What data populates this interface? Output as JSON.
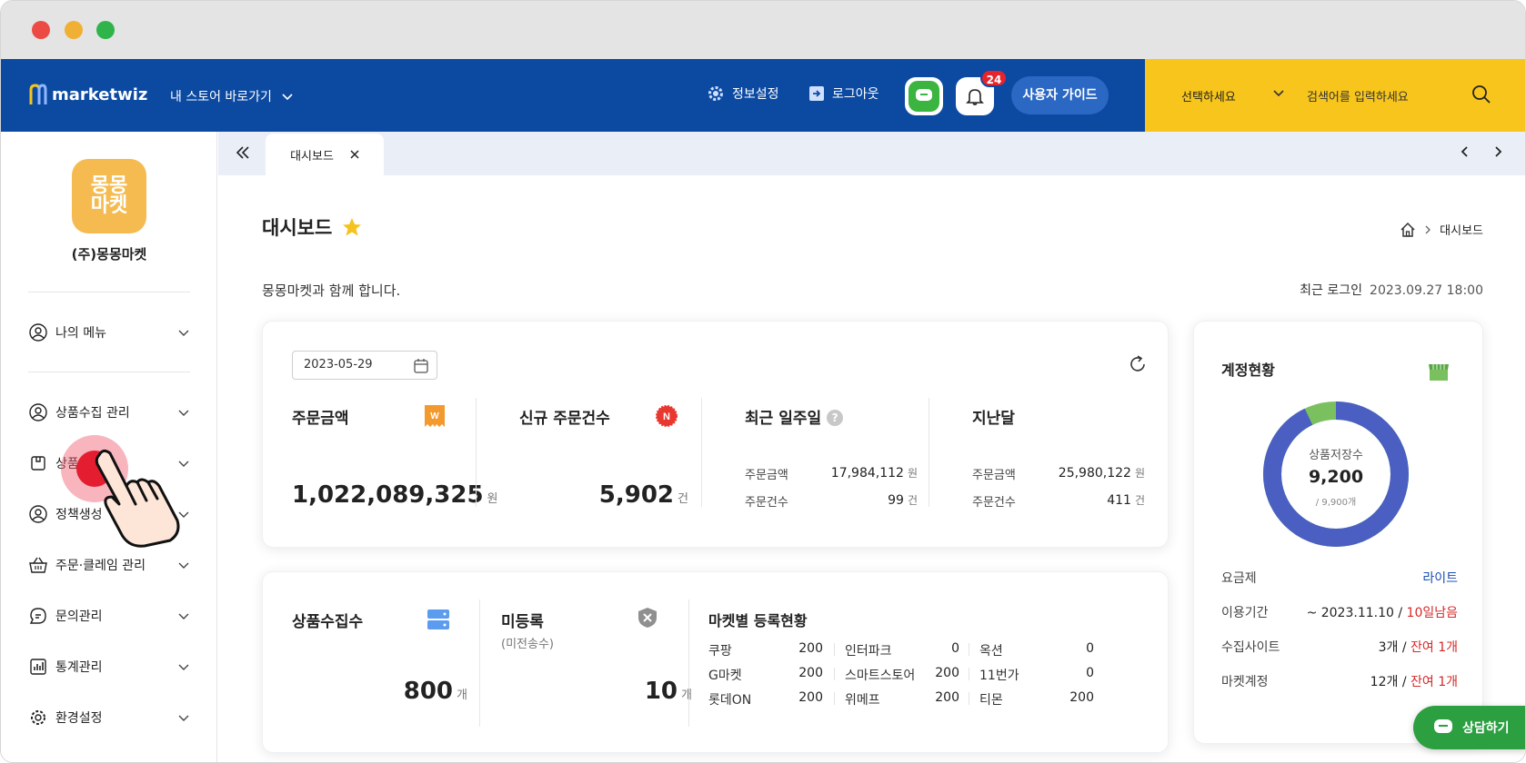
{
  "header": {
    "logo_text": "marketwiz",
    "store_link": "내 스토어 바로가기",
    "settings": "정보설정",
    "logout": "로그아웃",
    "notification_count": "24",
    "guide": "사용자 가이드",
    "select_label": "선택하세요",
    "search_placeholder": "검색어를 입력하세요"
  },
  "sidebar": {
    "shop_logo_text": "몽몽마켓",
    "shop_name": "(주)몽몽마켓",
    "items": [
      {
        "label": "나의 메뉴",
        "icon": "user-circle-icon"
      },
      {
        "label": "상품수집 관리",
        "icon": "user-circle-icon"
      },
      {
        "label": "상품",
        "icon": "box-icon"
      },
      {
        "label": "정책생성",
        "icon": "user-circle-icon"
      },
      {
        "label": "주문·클레임 관리",
        "icon": "basket-icon"
      },
      {
        "label": "문의관리",
        "icon": "chat-icon"
      },
      {
        "label": "통계관리",
        "icon": "bar-chart-icon"
      },
      {
        "label": "환경설정",
        "icon": "gear-icon"
      }
    ]
  },
  "tabs": {
    "active": "대시보드"
  },
  "page": {
    "title": "대시보드",
    "breadcrumb_current": "대시보드",
    "welcome": "몽몽마켓과 함께 합니다.",
    "last_login_label": "최근 로그인",
    "last_login_value": "2023.09.27 18:00"
  },
  "orders": {
    "date": "2023-05-29",
    "amount_label": "주문금액",
    "amount_value": "1,022,089,325",
    "amount_unit": "원",
    "new_label": "신규 주문건수",
    "new_value": "5,902",
    "new_unit": "건",
    "week_label": "최근 일주일",
    "week_amount_label": "주문금액",
    "week_amount_value": "17,984,112",
    "week_count_label": "주문건수",
    "week_count_value": "99",
    "month_label": "지난달",
    "month_amount_label": "주문금액",
    "month_amount_value": "25,980,122",
    "month_count_label": "주문건수",
    "month_count_value": "411",
    "won": "원",
    "gun": "건",
    "badge_w": "W",
    "badge_n": "N",
    "help": "?"
  },
  "products": {
    "collected_label": "상품수집수",
    "collected_value": "800",
    "collected_unit": "개",
    "unregistered_label": "미등록",
    "unregistered_sub": "(미전송수)",
    "unregistered_value": "10",
    "unregistered_unit": "개",
    "market_title": "마켓별 등록현황",
    "markets": [
      {
        "name": "쿠팡",
        "value": "200"
      },
      {
        "name": "인터파크",
        "value": "0"
      },
      {
        "name": "옥션",
        "value": "0"
      },
      {
        "name": "G마켓",
        "value": "200"
      },
      {
        "name": "스마트스토어",
        "value": "200"
      },
      {
        "name": "11번가",
        "value": "0"
      },
      {
        "name": "롯데ON",
        "value": "200"
      },
      {
        "name": "위메프",
        "value": "200"
      },
      {
        "name": "티몬",
        "value": "200"
      }
    ]
  },
  "account": {
    "title": "계정현황",
    "donut_label": "상품저장수",
    "donut_value": "9,200",
    "donut_total": "/ 9,900개",
    "donut_fraction": 0.929,
    "plan_label": "요금제",
    "plan_value": "라이트",
    "period_label": "이용기간",
    "period_value": "~ 2023.11.10 /",
    "period_remain": "10일남음",
    "sites_label": "수집사이트",
    "sites_value": "3개 /",
    "sites_remain": "잔여 1개",
    "market_label": "마켓계정",
    "market_value": "12개 /",
    "market_remain": "잔여 1개",
    "colors": {
      "used": "#4a5fc1",
      "remaining": "#7ac05f"
    }
  },
  "consult": "상담하기"
}
